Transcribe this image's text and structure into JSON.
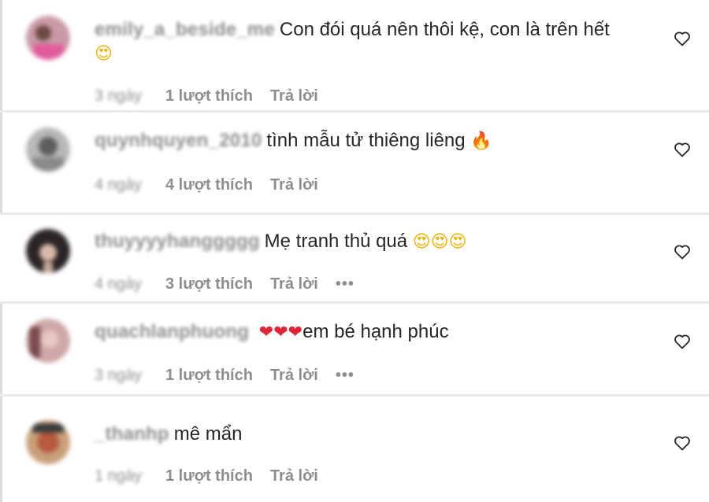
{
  "comments": [
    {
      "username": "emily_a_beside_me",
      "text": "Con đói quá nên thôi kệ, con là trên hết",
      "text_emoji": "",
      "line2": "😍",
      "time": "3 ngày",
      "likes": "1 lượt thích",
      "reply": "Trả lời",
      "more": "",
      "avatar_color": "#c99aa6",
      "avatar_accent": "#e25c9c"
    },
    {
      "username": "quynhquyen_2010",
      "text": "tình mẫu tử thiêng liêng",
      "text_emoji": "🔥",
      "line2": "",
      "time": "4 ngày",
      "likes": "4 lượt thích",
      "reply": "Trả lời",
      "more": "",
      "avatar_color": "#9e9e9e",
      "avatar_accent": "#5e5e5e"
    },
    {
      "username": "thuyyyyhanggggg",
      "text": "Mẹ tranh thủ quá",
      "text_emoji": "😍😍😍",
      "line2": "",
      "time": "4 ngày",
      "likes": "3 lượt thích",
      "reply": "Trả lời",
      "more": "•••",
      "avatar_color": "#2b2424",
      "avatar_accent": "#d8b9a8"
    },
    {
      "username": "quachlanphuong",
      "text": "em bé hạnh phúc",
      "text_emoji": "❤❤❤",
      "line2": "",
      "time": "3 ngày",
      "likes": "1 lượt thích",
      "reply": "Trả lời",
      "more": "•••",
      "avatar_color": "#cfa7a8",
      "avatar_accent": "#7a4b50"
    },
    {
      "username": "_thanhp",
      "text": "mê mẩn",
      "text_emoji": "",
      "line2": "",
      "time": "1 ngày",
      "likes": "1 lượt thích",
      "reply": "Trả lời",
      "more": "",
      "avatar_color": "#b85a3e",
      "avatar_accent": "#3b3b3b"
    }
  ],
  "icons": {
    "like": "heart-outline-icon"
  },
  "colors": {
    "text": "#262626",
    "muted": "#8e8e8e",
    "separator": "#e9e9e9"
  }
}
